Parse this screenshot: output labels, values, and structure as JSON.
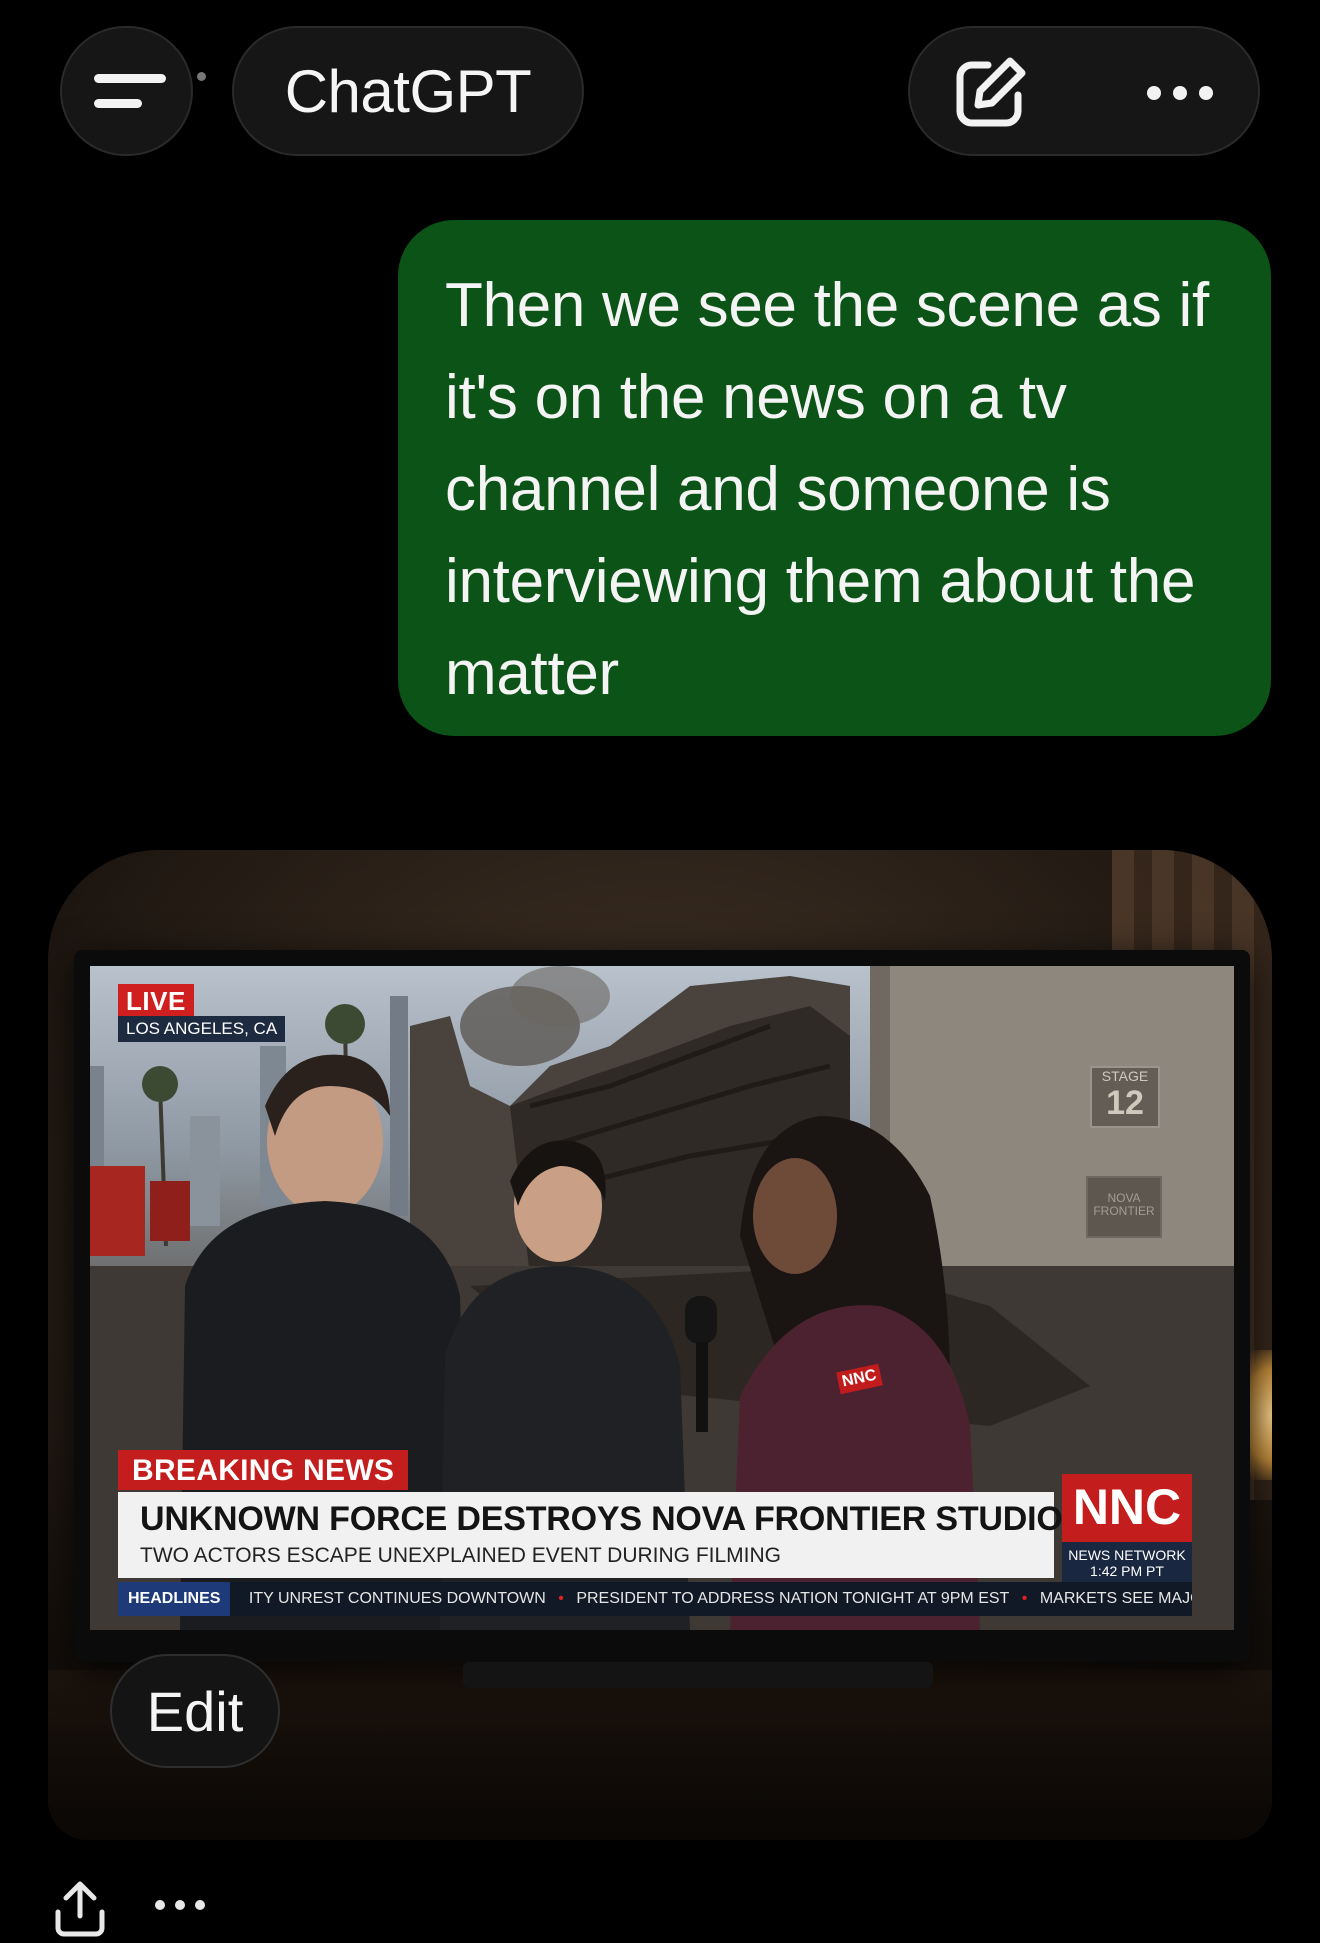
{
  "header": {
    "title": "ChatGPT",
    "menu_icon": "hamburger-menu-icon",
    "new_chat_icon": "edit-pencil-icon",
    "more_icon": "more-horizontal-icon"
  },
  "conversation": {
    "user_message": "Then we see the scene as if it's on the news on a tv channel and someone is interviewing them about the matter"
  },
  "generated_image": {
    "live_label": "LIVE",
    "location": "LOS ANGELES, CA",
    "stage_label": "STAGE",
    "stage_number": "12",
    "studio_sign": "NOVA FRONTIER",
    "mic_flag": "NNC",
    "breaking_label": "BREAKING NEWS",
    "headline": "UNKNOWN FORCE DESTROYS NOVA FRONTIER STUDIOS",
    "subheadline": "TWO ACTORS ESCAPE UNEXPLAINED EVENT DURING FILMING",
    "network_logo": "NNC",
    "network_name": "NEWS NETWORK",
    "network_time": "1:42 PM PT",
    "ticker_label": "HEADLINES",
    "ticker_items": [
      "ITY UNREST CONTINUES DOWNTOWN",
      "PRESIDENT TO ADDRESS NATION TONIGHT AT 9PM EST",
      "MARKETS SEE MAJOR FLUCTUA"
    ]
  },
  "image_actions": {
    "edit_label": "Edit"
  },
  "message_actions": {
    "share_icon": "share-upload-icon",
    "more_icon": "more-horizontal-icon"
  },
  "colors": {
    "background": "#000000",
    "user_bubble": "#0b5316",
    "pill": "#161616",
    "breaking_red": "#c31d1d"
  }
}
